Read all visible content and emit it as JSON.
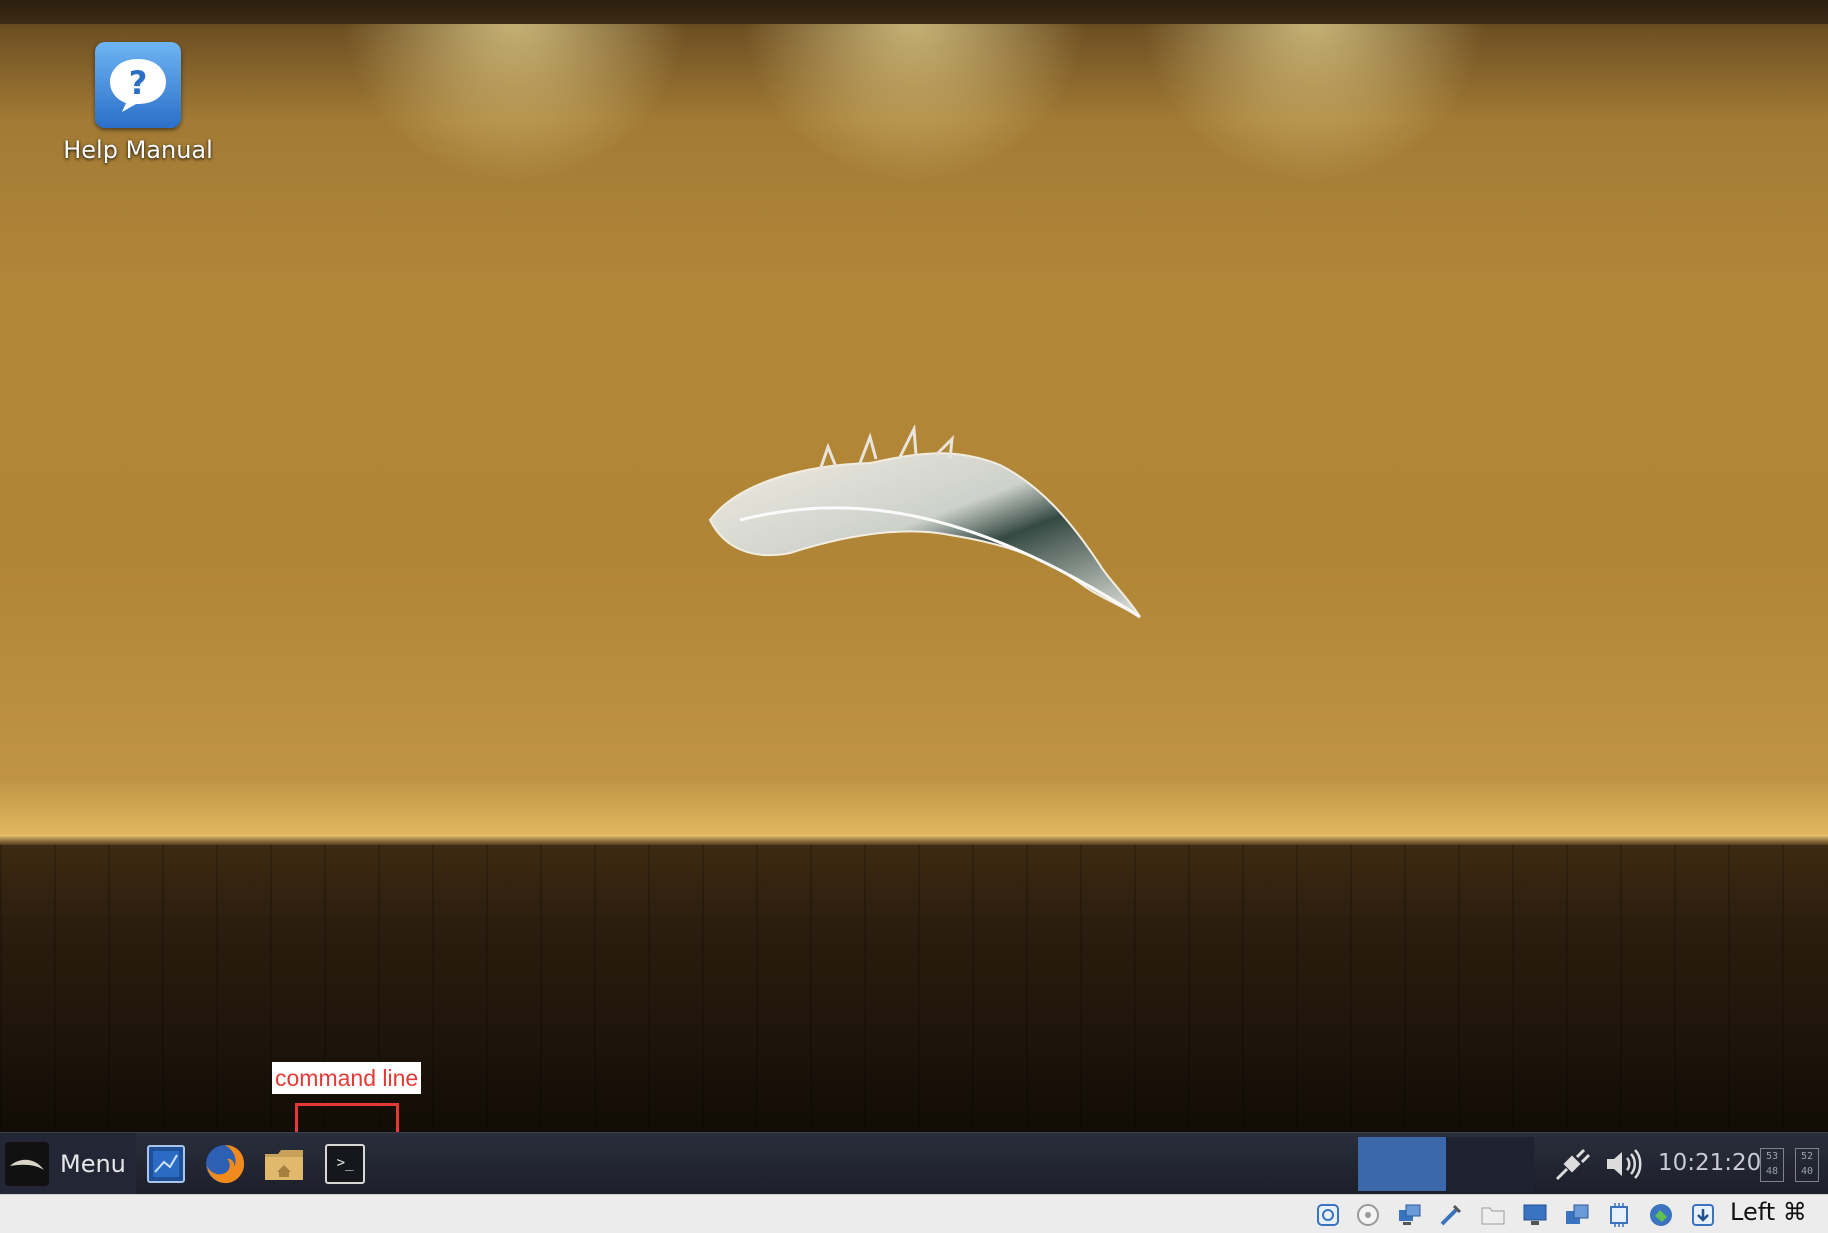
{
  "desktop": {
    "icons": [
      {
        "label": "Help Manual",
        "icon": "help-question-icon"
      }
    ],
    "wallpaper": "golden-wall-with-feather",
    "annotation": {
      "label": "command line",
      "color": "#e53935"
    }
  },
  "taskbar": {
    "menu_label": "Menu",
    "launchers": [
      {
        "name": "monitor-app-icon"
      },
      {
        "name": "firefox-icon"
      },
      {
        "name": "home-folder-icon"
      },
      {
        "name": "terminal-icon",
        "glyph": ">_"
      }
    ],
    "workspaces": [
      "workspace-1",
      "workspace-2"
    ],
    "active_workspace": 1,
    "clock": "10:21:20",
    "netmon": [
      [
        "53",
        "48"
      ],
      [
        "52",
        "40"
      ]
    ]
  },
  "host_status": {
    "host_key_label": "Left ⌘"
  }
}
